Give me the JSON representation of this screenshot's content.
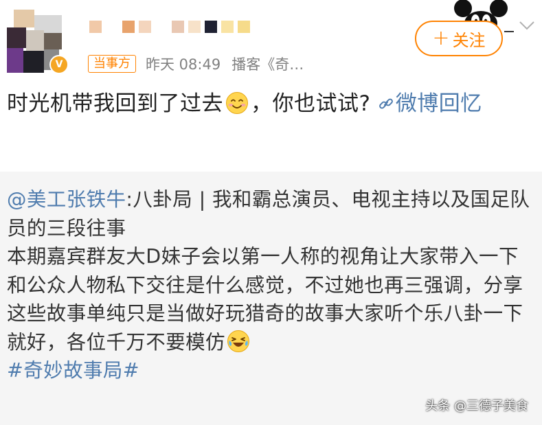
{
  "header": {
    "tag": "当事方",
    "time": "昨天 08:49",
    "source": "播客《奇…",
    "follow_label": "关注",
    "follow_plus": "+"
  },
  "post": {
    "text_before_emoji": "时光机带我回到了过去",
    "text_after_emoji": "，你也试试?",
    "link_text": "微博回忆"
  },
  "repost": {
    "mention": "@美工张铁牛",
    "body_first": ":八卦局 | 我和霸总演员、电视主持以及国足队员的三段往事",
    "body_second": "本期嘉宾群友大D妹子会以第一人称的视角让大家带入一下和公众人物私下交往是什么感觉，不过她也再三强调，分享这些故事单纯只是当做好玩猎奇的故事大家听个乐八卦一下就好，各位千万不要模仿",
    "hashtag": "#奇妙故事局#"
  },
  "watermark": "头条 @三德子美食",
  "colors": {
    "accent": "#ff8200",
    "link": "#4f7cae",
    "repost_bg": "#f5f5f5"
  },
  "icons": {
    "verified": "verified-badge-icon",
    "link": "link-icon",
    "emoji_smile": "smile-emoji-icon",
    "emoji_laugh": "laugh-cry-emoji-icon",
    "more": "chevron-down-icon"
  }
}
